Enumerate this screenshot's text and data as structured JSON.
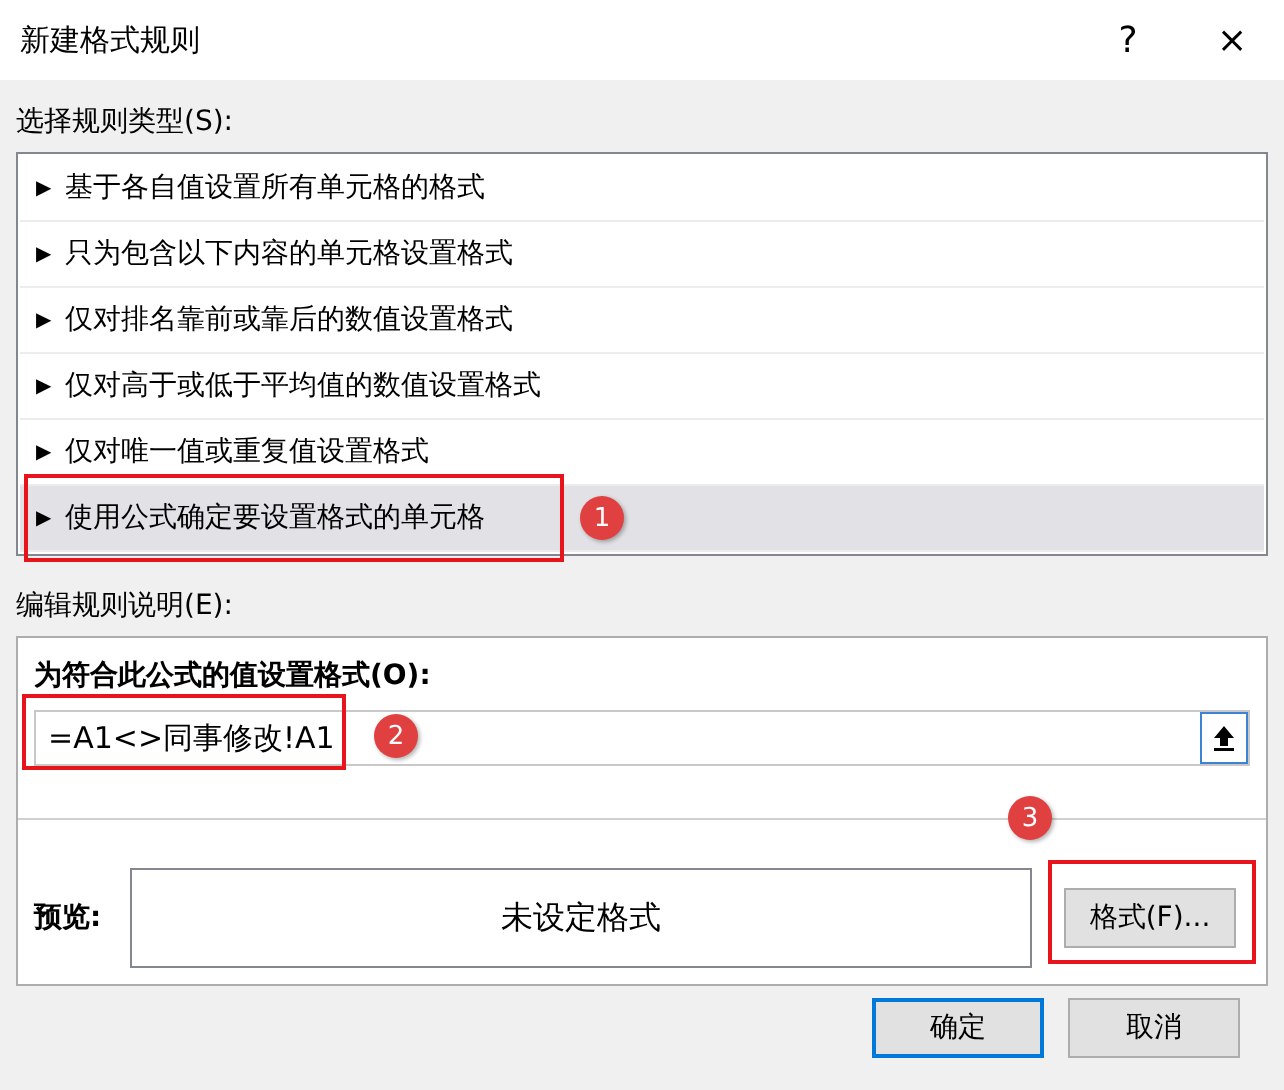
{
  "window": {
    "title": "新建格式规则",
    "help": "?",
    "close": "×"
  },
  "rule_type": {
    "label": "选择规则类型(S):",
    "items": [
      {
        "marker": "▶",
        "label": "基于各自值设置所有单元格的格式",
        "selected": false
      },
      {
        "marker": "▶",
        "label": "只为包含以下内容的单元格设置格式",
        "selected": false
      },
      {
        "marker": "▶",
        "label": "仅对排名靠前或靠后的数值设置格式",
        "selected": false
      },
      {
        "marker": "▶",
        "label": "仅对高于或低于平均值的数值设置格式",
        "selected": false
      },
      {
        "marker": "▶",
        "label": "仅对唯一值或重复值设置格式",
        "selected": false
      },
      {
        "marker": "▶",
        "label": "使用公式确定要设置格式的单元格",
        "selected": true,
        "annotation": "1"
      }
    ]
  },
  "description": {
    "label": "编辑规则说明(E):",
    "formula_label": "为符合此公式的值设置格式(O):",
    "formula": {
      "value": "=A1<>同事修改!A1",
      "annotation": "2"
    },
    "preview_label": "预览:",
    "preview": "未设定格式",
    "format_button": {
      "label": "格式(F)...",
      "annotation": "3"
    }
  },
  "buttons": [
    {
      "label": "确定",
      "default": true
    },
    {
      "label": "取消",
      "default": false
    }
  ]
}
